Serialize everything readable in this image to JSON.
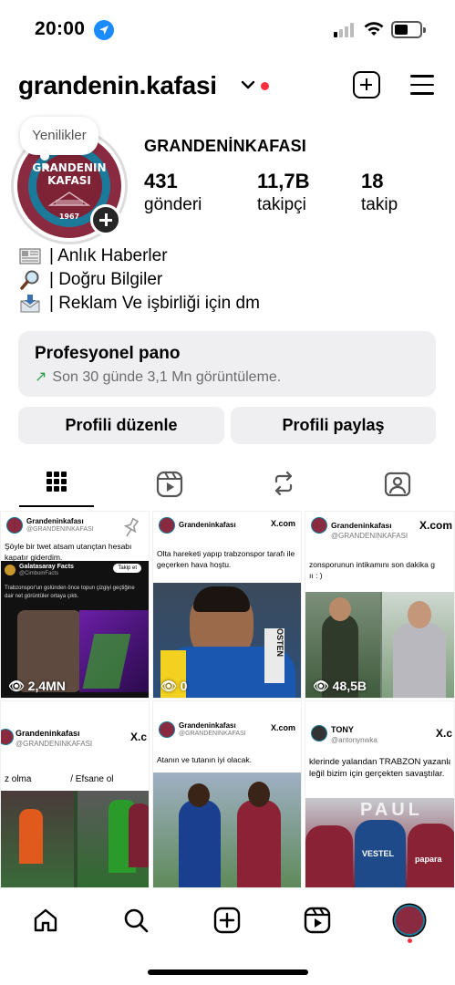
{
  "status_bar": {
    "time": "20:00"
  },
  "header": {
    "username": "grandenin.kafasi"
  },
  "profile": {
    "story_bubble": "Yenilikler",
    "avatar_text_top": "GRANDENIN",
    "avatar_text_mid": "KAFASI",
    "avatar_year": "1967",
    "display_name": "GRANDENİNKAFASI",
    "stats": [
      {
        "value": "431",
        "label": "gönderi"
      },
      {
        "value": "11,7B",
        "label": "takipçi"
      },
      {
        "value": "18",
        "label": "takip"
      }
    ],
    "bio": [
      {
        "icon": "newspaper-icon",
        "text": "| Anlık Haberler"
      },
      {
        "icon": "magnifier-icon",
        "text": "| Doğru Bilgiler"
      },
      {
        "icon": "envelope-icon",
        "text": "| Reklam Ve işbirliği için dm"
      }
    ]
  },
  "pro_panel": {
    "title": "Profesyonel pano",
    "subtitle": "Son 30 günde 3,1 Mn görüntüleme."
  },
  "buttons": {
    "edit": "Profili düzenle",
    "share": "Profili paylaş"
  },
  "grid": [
    {
      "name": "Grandeninkafası",
      "handle": "@GRANDENINKAFASI",
      "text1": "Şöyle bir twet atsam utançtan hesabı",
      "text2": "kapatır giderdim.",
      "quote_name": "Galatasaray Facts",
      "quote_handle": "@CimbomFacts",
      "quote_button": "Takip et",
      "quote_text1": "Trabzonspor'un golünden önce topun çizgiyi geçtiğine",
      "quote_text2": "dair net görüntüler ortaya çıktı.",
      "views": "2,4MN"
    },
    {
      "name": "Grandeninkafası",
      "handle": "@GRANDENINKAFASI",
      "source": "X.com",
      "text1": "Olta hareketi yapıp trabzonspor tarafı ile dalga",
      "text2": "geçerken hava hoştu.",
      "views": "0"
    },
    {
      "name": "Grandeninkafası",
      "handle": "@GRANDENINKAFASI",
      "source": "X.com",
      "text1": "zonsporunun intikamını son dakika g",
      "text2": "ıı : )",
      "views": "48,5B"
    },
    {
      "name": "Grandeninkafası",
      "handle": "@GRANDENINKAFASI",
      "source": "X.c",
      "text1": "z olma",
      "text2": "/     Efsane ol"
    },
    {
      "name": "Grandeninkafası",
      "handle": "@GRANDENINKAFASI",
      "source": "X.com",
      "text1": "Atanın ve tutanın iyi olacak."
    },
    {
      "name": "TONY",
      "handle": "@antonynwka",
      "source": "X.c",
      "text1": "klerinde yalandan TRABZON yazanla",
      "text2": "leğil bizim için gerçekten savaştılar.",
      "photo_text1": "PAUL",
      "photo_text2": "VESTEL",
      "photo_text3": "papara"
    }
  ],
  "colors": {
    "brand_maroon": "#8a2a40",
    "brand_blue": "#1b7a9a",
    "notification_red": "#ff2d3d",
    "panel_gray": "#efeff1",
    "growth_green": "#2a9d4a"
  }
}
